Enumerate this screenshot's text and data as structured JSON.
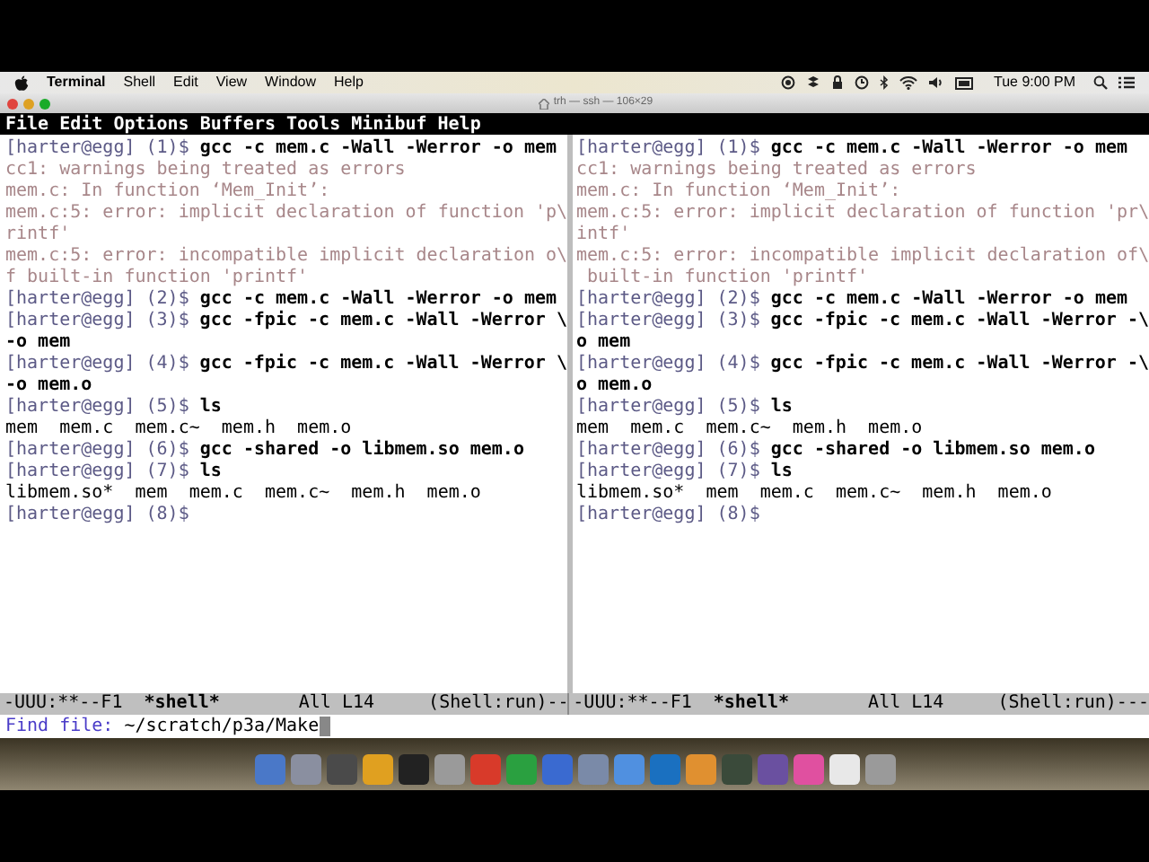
{
  "menu_bar": {
    "app": "Terminal",
    "items": [
      "Shell",
      "Edit",
      "View",
      "Window",
      "Help"
    ],
    "clock": "Tue 9:00 PM"
  },
  "window": {
    "title": "trh — ssh — 106×29"
  },
  "emacs_menu": [
    "File",
    "Edit",
    "Options",
    "Buffers",
    "Tools",
    "Minibuf",
    "Help"
  ],
  "panes": [
    {
      "lines": [
        {
          "kind": "command",
          "prompt": "[harter@egg] (1)$",
          "command": "gcc -c mem.c -Wall -Werror -o mem"
        },
        {
          "kind": "output",
          "text": "cc1: warnings being treated as errors"
        },
        {
          "kind": "output",
          "text": "mem.c: In function ‘Mem_Init’:"
        },
        {
          "kind": "output",
          "text": "mem.c:5: error: implicit declaration of function 'p\\"
        },
        {
          "kind": "output",
          "text": "rintf'"
        },
        {
          "kind": "output",
          "text": "mem.c:5: error: incompatible implicit declaration o\\"
        },
        {
          "kind": "output",
          "text": "f built-in function 'printf'"
        },
        {
          "kind": "command",
          "prompt": "[harter@egg] (2)$",
          "command": "gcc -c mem.c -Wall -Werror -o mem"
        },
        {
          "kind": "command",
          "prompt": "[harter@egg] (3)$",
          "command": "gcc -fpic -c mem.c -Wall -Werror \\"
        },
        {
          "kind": "continuation",
          "text": "-o mem"
        },
        {
          "kind": "command",
          "prompt": "[harter@egg] (4)$",
          "command": "gcc -fpic -c mem.c -Wall -Werror \\"
        },
        {
          "kind": "continuation",
          "text": "-o mem.o"
        },
        {
          "kind": "command",
          "prompt": "[harter@egg] (5)$",
          "command": "ls"
        },
        {
          "kind": "listing",
          "text": "mem  mem.c  mem.c~  mem.h  mem.o"
        },
        {
          "kind": "command",
          "prompt": "[harter@egg] (6)$",
          "command": "gcc -shared -o libmem.so mem.o"
        },
        {
          "kind": "command",
          "prompt": "[harter@egg] (7)$",
          "command": "ls"
        },
        {
          "kind": "listing",
          "text": "libmem.so*  mem  mem.c  mem.c~  mem.h  mem.o"
        },
        {
          "kind": "command",
          "prompt": "[harter@egg] (8)$"
        }
      ],
      "mode_line": {
        "status": "-UUU:**--F1",
        "buffer": "*shell*",
        "position": "All L14",
        "mode": "(Shell:run)--"
      }
    },
    {
      "lines": [
        {
          "kind": "command",
          "prompt": "[harter@egg] (1)$",
          "command": "gcc -c mem.c -Wall -Werror -o mem"
        },
        {
          "kind": "output",
          "text": "cc1: warnings being treated as errors"
        },
        {
          "kind": "output",
          "text": "mem.c: In function ‘Mem_Init’:"
        },
        {
          "kind": "output",
          "text": "mem.c:5: error: implicit declaration of function 'pr\\"
        },
        {
          "kind": "output",
          "text": "intf'"
        },
        {
          "kind": "output",
          "text": "mem.c:5: error: incompatible implicit declaration of\\"
        },
        {
          "kind": "output",
          "text": " built-in function 'printf'"
        },
        {
          "kind": "command",
          "prompt": "[harter@egg] (2)$",
          "command": "gcc -c mem.c -Wall -Werror -o mem"
        },
        {
          "kind": "command",
          "prompt": "[harter@egg] (3)$",
          "command": "gcc -fpic -c mem.c -Wall -Werror -\\"
        },
        {
          "kind": "continuation",
          "text": "o mem"
        },
        {
          "kind": "command",
          "prompt": "[harter@egg] (4)$",
          "command": "gcc -fpic -c mem.c -Wall -Werror -\\"
        },
        {
          "kind": "continuation",
          "text": "o mem.o"
        },
        {
          "kind": "command",
          "prompt": "[harter@egg] (5)$",
          "command": "ls"
        },
        {
          "kind": "listing",
          "text": "mem  mem.c  mem.c~  mem.h  mem.o"
        },
        {
          "kind": "command",
          "prompt": "[harter@egg] (6)$",
          "command": "gcc -shared -o libmem.so mem.o"
        },
        {
          "kind": "command",
          "prompt": "[harter@egg] (7)$",
          "command": "ls"
        },
        {
          "kind": "listing",
          "text": "libmem.so*  mem  mem.c  mem.c~  mem.h  mem.o"
        },
        {
          "kind": "command",
          "prompt": "[harter@egg] (8)$"
        }
      ],
      "mode_line": {
        "status": "-UUU:**--F1",
        "buffer": "*shell*",
        "position": "All L14",
        "mode": "(Shell:run)---"
      }
    }
  ],
  "minibuffer": {
    "prompt": "Find file:",
    "value": "~/scratch/p3a/Make"
  }
}
